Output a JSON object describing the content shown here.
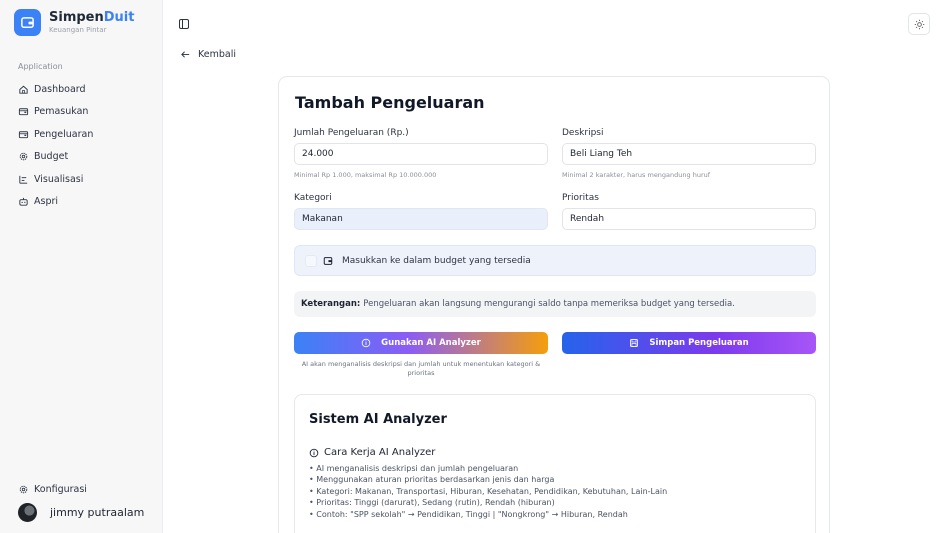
{
  "brand": {
    "name_main": "Simpen",
    "name_accent": "Duit",
    "tagline": "Keuangan Pintar"
  },
  "sidebar": {
    "section_label": "Application",
    "items": [
      {
        "label": "Dashboard",
        "icon": "home-icon"
      },
      {
        "label": "Pemasukan",
        "icon": "wallet-icon"
      },
      {
        "label": "Pengeluaran",
        "icon": "wallet-icon"
      },
      {
        "label": "Budget",
        "icon": "gear-icon"
      },
      {
        "label": "Visualisasi",
        "icon": "chart-icon"
      },
      {
        "label": "Aspri",
        "icon": "bot-icon"
      }
    ],
    "settings_label": "Konfigurasi",
    "user_name": "jimmy putraalam"
  },
  "header": {
    "back_label": "Kembali"
  },
  "form": {
    "title": "Tambah Pengeluaran",
    "amount_label": "Jumlah Pengeluaran (Rp.)",
    "amount_value": "24.000",
    "amount_hint": "Minimal Rp 1.000, maksimal Rp 10.000.000",
    "description_label": "Deskripsi",
    "description_value": "Beli Liang Teh",
    "description_hint": "Minimal 2 karakter, harus mengandung huruf",
    "category_label": "Kategori",
    "category_value": "Makanan",
    "priority_label": "Prioritas",
    "priority_value": "Rendah",
    "budget_checkbox_label": "Masukkan ke dalam budget yang tersedia",
    "note_title": "Keterangan:",
    "note_text": "Pengeluaran akan langsung mengurangi saldo tanpa memeriksa budget yang tersedia.",
    "ai_button_label": "Gunakan AI Analyzer",
    "save_button_label": "Simpan Pengeluaran",
    "ai_hint": "AI akan menganalisis deskripsi dan jumlah untuk menentukan kategori & prioritas"
  },
  "ai_section": {
    "title": "Sistem AI Analyzer",
    "howto_title": "Cara Kerja AI Analyzer",
    "bullets": [
      "AI menganalisis deskripsi dan jumlah pengeluaran",
      "Menggunakan aturan prioritas berdasarkan jenis dan harga",
      "Kategori: Makanan, Transportasi, Hiburan, Kesehatan, Pendidikan, Kebutuhan, Lain-Lain",
      "Prioritas: Tinggi (darurat), Sedang (rutin), Rendah (hiburan)",
      "Contoh: \"SPP sekolah\" → Pendidikan, Tinggi | \"Nongkrong\" → Hiburan, Rendah"
    ]
  },
  "colors": {
    "accent": "#3b82f6",
    "select_bg": "#eaf0fb",
    "budget_box_bg": "#eef3fb"
  }
}
